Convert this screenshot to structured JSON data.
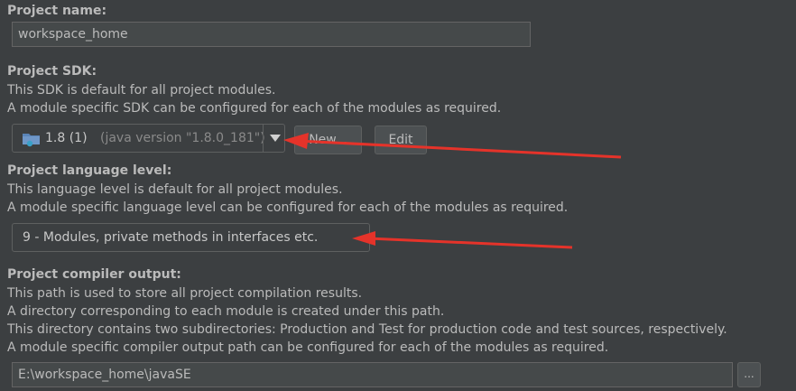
{
  "project_name": {
    "label": "Project name:",
    "value": "workspace_home"
  },
  "project_sdk": {
    "label": "Project SDK:",
    "desc1": "This SDK is default for all project modules.",
    "desc2": "A module specific SDK can be configured for each of the modules as required.",
    "selected_version": "1.8 (1)",
    "selected_detail": "(java version \"1.8.0_181\")",
    "new_button": "New...",
    "edit_button": "Edit"
  },
  "language_level": {
    "label": "Project language level:",
    "desc1": "This language level is default for all project modules.",
    "desc2": "A module specific language level can be configured for each of the modules as required.",
    "selected": "9 - Modules, private methods in interfaces etc."
  },
  "compiler_output": {
    "label": "Project compiler output:",
    "desc1": "This path is used to store all project compilation results.",
    "desc2": "A directory corresponding to each module is created under this path.",
    "desc3": "This directory contains two subdirectories: Production and Test for production code and test sources, respectively.",
    "desc4": "A module specific compiler output path can be configured for each of the modules as required.",
    "path": "E:\\workspace_home\\javaSE",
    "browse_button": "..."
  },
  "colors": {
    "background": "#3c3f41",
    "text": "#bbbbbb",
    "annotation_arrow": "#e5332a",
    "folder_icon": "#5a84b8"
  }
}
